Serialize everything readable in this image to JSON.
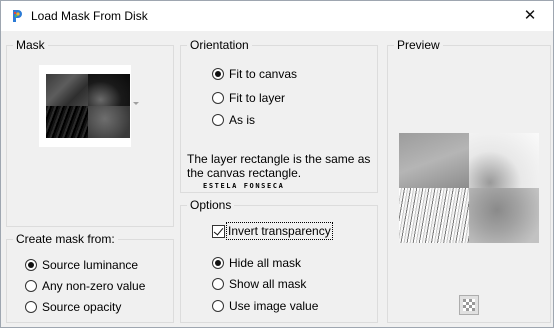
{
  "window": {
    "title": "Load Mask From Disk",
    "close_glyph": "✕"
  },
  "mask": {
    "group_label": "Mask",
    "dropdown_icon": "chevron-down-icon"
  },
  "create_mask_from": {
    "group_label": "Create mask from:",
    "options": [
      {
        "label": "Source luminance",
        "selected": true
      },
      {
        "label": "Any non-zero value",
        "selected": false
      },
      {
        "label": "Source opacity",
        "selected": false
      }
    ]
  },
  "orientation": {
    "group_label": "Orientation",
    "options": [
      {
        "label": "Fit to canvas",
        "selected": true
      },
      {
        "label": "Fit to layer",
        "selected": false
      },
      {
        "label": "As is",
        "selected": false
      }
    ],
    "description": "The layer rectangle is the same as the canvas rectangle.",
    "watermark": "ESTELA FONSECA"
  },
  "options": {
    "group_label": "Options",
    "invert_label": "Invert transparency",
    "invert_checked": true,
    "show_options": [
      {
        "label": "Hide all mask",
        "selected": true
      },
      {
        "label": "Show all mask",
        "selected": false
      },
      {
        "label": "Use image value",
        "selected": false
      }
    ]
  },
  "preview": {
    "group_label": "Preview",
    "transparency_icon": "checkerboard-icon"
  },
  "colors": {
    "window_bg": "#f0f0f0",
    "title_bg": "#ffffff",
    "group_border": "#dcdcdc"
  }
}
